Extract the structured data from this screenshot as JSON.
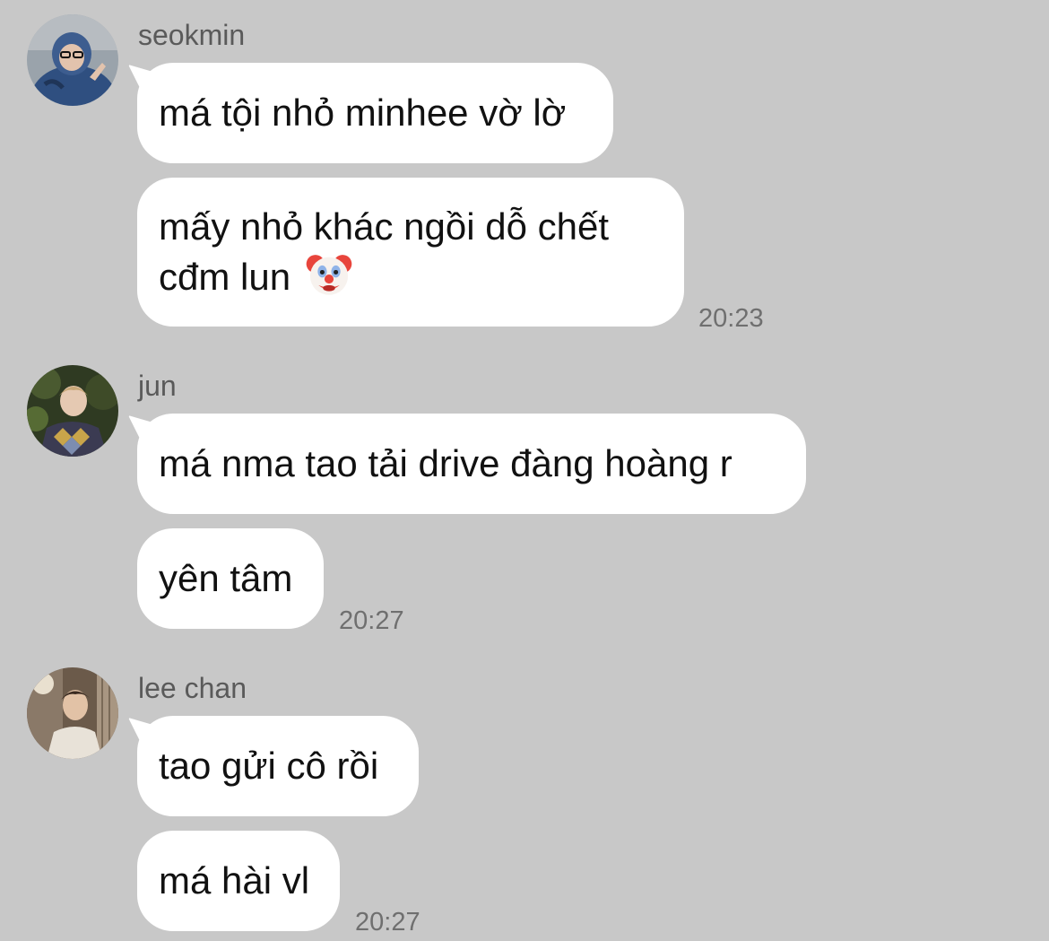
{
  "groups": [
    {
      "sender": "seokmin",
      "messages": [
        "má tội nhỏ minhee vờ lờ",
        "mấy nhỏ khác ngồi dỗ chết",
        "cđm lun"
      ],
      "time": "20:23"
    },
    {
      "sender": "jun",
      "messages": [
        "má nma tao tải drive đàng hoàng r",
        "yên tâm"
      ],
      "time": "20:27"
    },
    {
      "sender": "lee chan",
      "messages": [
        "tao gửi cô rồi",
        "má hài vl"
      ],
      "time": "20:27"
    }
  ],
  "icons": {
    "clown_emoji": "clown-face-emoji",
    "avatar_seokmin": "avatar-photo",
    "avatar_jun": "avatar-photo",
    "avatar_lee_chan": "avatar-photo"
  },
  "colors": {
    "background": "#c8c8c8",
    "bubble": "#ffffff",
    "sender_text": "#5a5a5a",
    "time_text": "#6f6f6f"
  }
}
